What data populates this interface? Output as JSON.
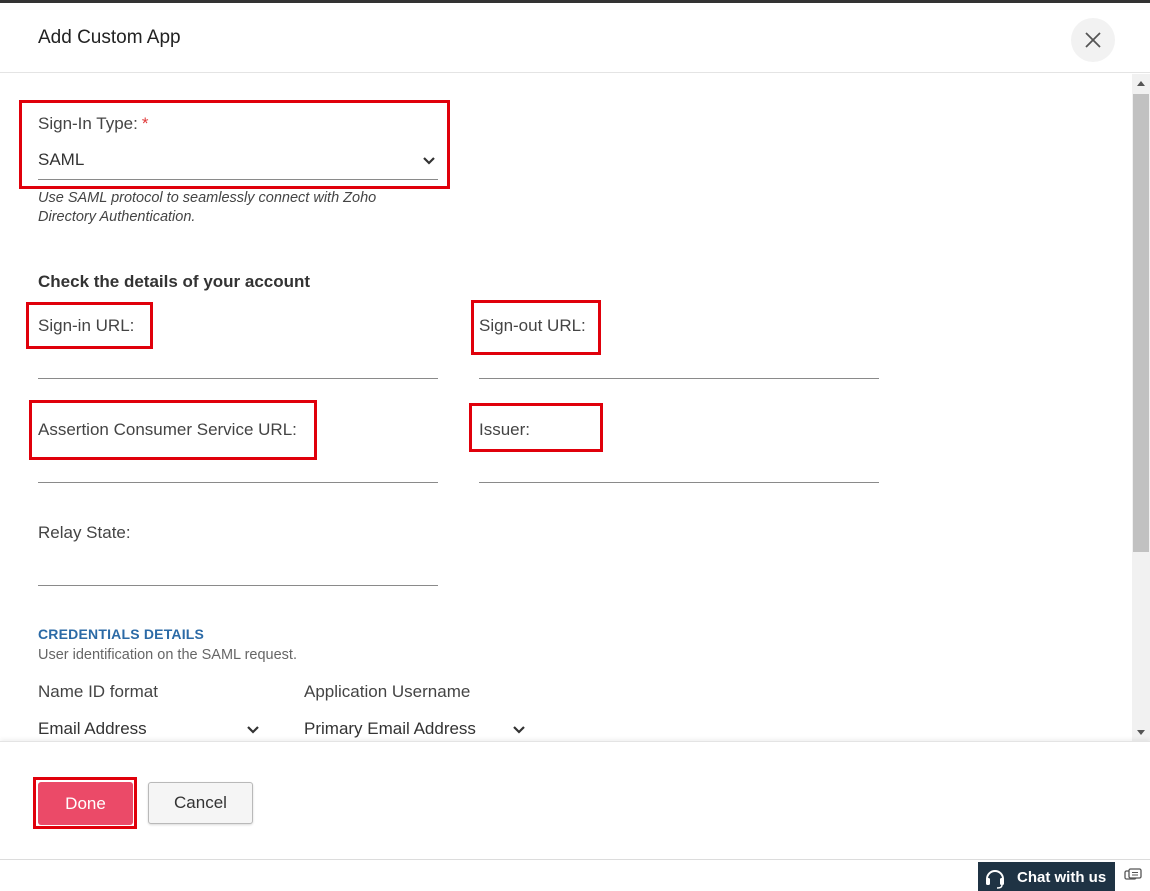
{
  "dialog": {
    "title": "Add Custom App"
  },
  "sign_in_type": {
    "label": "Sign-In Type:",
    "required_mark": "*",
    "value": "SAML",
    "hint_line1": "Use SAML protocol to seamlessly connect with Zoho",
    "hint_line2": "Directory Authentication."
  },
  "account": {
    "section_title": "Check the details of your account",
    "sign_in_url_label": "Sign-in URL:",
    "sign_in_url_value": "",
    "sign_out_url_label": "Sign-out URL:",
    "sign_out_url_value": "",
    "acs_url_label": "Assertion Consumer Service URL:",
    "acs_url_value": "",
    "issuer_label": "Issuer:",
    "issuer_value": "",
    "relay_state_label": "Relay State:",
    "relay_state_value": ""
  },
  "credentials": {
    "title": "CREDENTIALS DETAILS",
    "subtitle": "User identification on the SAML request.",
    "name_id_label": "Name ID format",
    "name_id_value": "Email Address",
    "app_username_label": "Application Username",
    "app_username_value": "Primary Email Address"
  },
  "footer": {
    "done_label": "Done",
    "cancel_label": "Cancel"
  },
  "chat": {
    "label": "Chat with us"
  },
  "colors": {
    "highlight": "#e0000b",
    "done_button": "#eb4a68",
    "section_link": "#2b6aa6",
    "chat_widget": "#1f3344"
  },
  "icons": {
    "close": "close-icon",
    "dropdown": "chevron-down-icon",
    "chat": "headset-icon",
    "chat_side": "chat-bubbles-icon"
  }
}
